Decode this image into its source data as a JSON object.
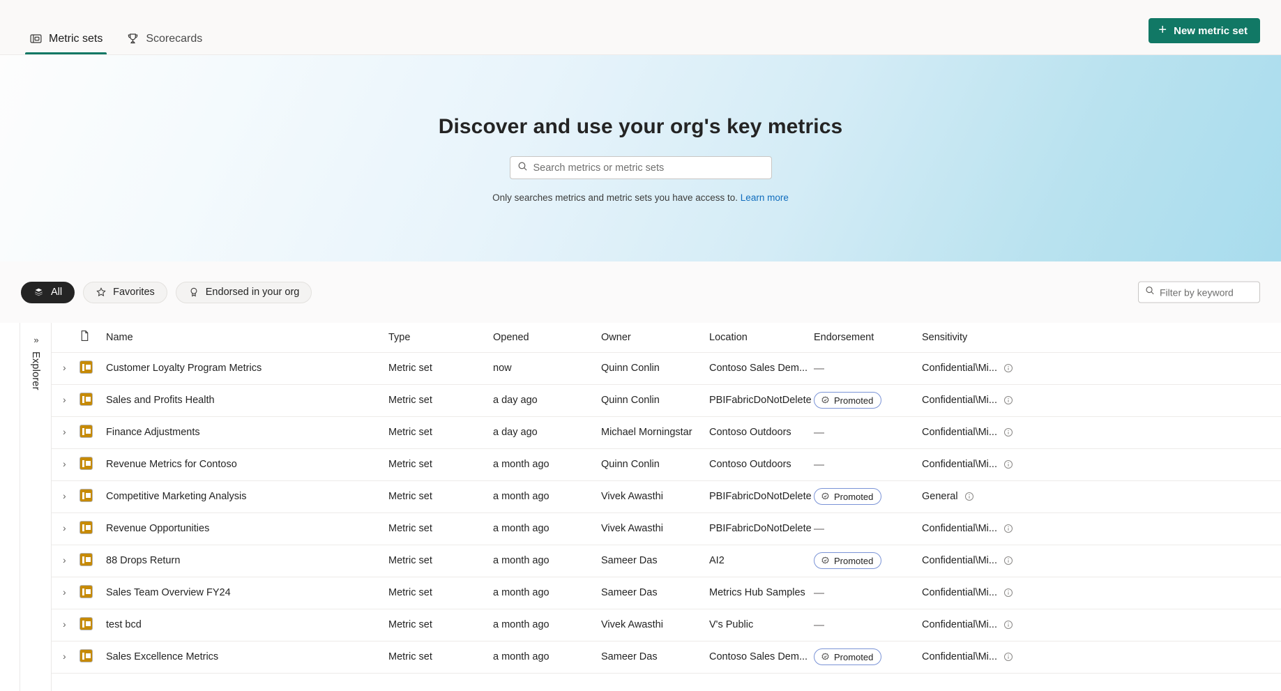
{
  "nav": {
    "tabs": [
      {
        "label": "Metric sets",
        "icon": "metric-set-icon",
        "active": true
      },
      {
        "label": "Scorecards",
        "icon": "trophy-icon",
        "active": false
      }
    ],
    "new_button": {
      "label": "New metric set",
      "icon": "plus-icon",
      "color": "#117865"
    }
  },
  "hero": {
    "title": "Discover and use your org's key metrics",
    "search": {
      "placeholder": "Search metrics or metric sets",
      "value": "",
      "icon": "search-icon"
    },
    "note": "Only searches metrics and metric sets you have access to.",
    "note_link": "Learn more",
    "link_color": "#0f6cbd"
  },
  "filters": {
    "pills": [
      {
        "label": "All",
        "icon": "stack-icon",
        "selected": true
      },
      {
        "label": "Favorites",
        "icon": "star-icon",
        "selected": false
      },
      {
        "label": "Endorsed in your org",
        "icon": "endorsement-icon",
        "selected": false
      }
    ],
    "keyword": {
      "placeholder": "Filter by keyword",
      "value": "",
      "icon": "search-icon"
    }
  },
  "explorer": {
    "label": "Explorer",
    "icon": "double-chevron-right-icon"
  },
  "table": {
    "columns": [
      "",
      "Name",
      "Type",
      "Opened",
      "Owner",
      "Location",
      "Endorsement",
      "Sensitivity"
    ],
    "header_icon": "document-icon",
    "rows": [
      {
        "name": "Customer Loyalty Program Metrics",
        "type": "Metric set",
        "opened": "now",
        "owner": "Quinn Conlin",
        "location": "Contoso Sales Dem...",
        "endorsement": "—",
        "sensitivity": "Confidential\\Mi..."
      },
      {
        "name": "Sales and Profits Health",
        "type": "Metric set",
        "opened": "a day ago",
        "owner": "Quinn Conlin",
        "location": "PBIFabricDoNotDelete",
        "endorsement": "Promoted",
        "sensitivity": "Confidential\\Mi..."
      },
      {
        "name": "Finance Adjustments",
        "type": "Metric set",
        "opened": "a day ago",
        "owner": "Michael Morningstar",
        "location": "Contoso Outdoors",
        "endorsement": "—",
        "sensitivity": "Confidential\\Mi..."
      },
      {
        "name": "Revenue Metrics for Contoso",
        "type": "Metric set",
        "opened": "a month ago",
        "owner": "Quinn Conlin",
        "location": "Contoso Outdoors",
        "endorsement": "—",
        "sensitivity": "Confidential\\Mi..."
      },
      {
        "name": "Competitive Marketing Analysis",
        "type": "Metric set",
        "opened": "a month ago",
        "owner": "Vivek Awasthi",
        "location": "PBIFabricDoNotDelete",
        "endorsement": "Promoted",
        "sensitivity": "General"
      },
      {
        "name": "Revenue Opportunities",
        "type": "Metric set",
        "opened": "a month ago",
        "owner": "Vivek Awasthi",
        "location": "PBIFabricDoNotDelete",
        "endorsement": "—",
        "sensitivity": "Confidential\\Mi..."
      },
      {
        "name": "88 Drops Return",
        "type": "Metric set",
        "opened": "a month ago",
        "owner": "Sameer Das",
        "location": "AI2",
        "endorsement": "Promoted",
        "sensitivity": "Confidential\\Mi..."
      },
      {
        "name": "Sales Team Overview FY24",
        "type": "Metric set",
        "opened": "a month ago",
        "owner": "Sameer Das",
        "location": "Metrics Hub Samples",
        "endorsement": "—",
        "sensitivity": "Confidential\\Mi..."
      },
      {
        "name": "test bcd",
        "type": "Metric set",
        "opened": "a month ago",
        "owner": "Vivek Awasthi",
        "location": "V's Public",
        "endorsement": "—",
        "sensitivity": "Confidential\\Mi..."
      },
      {
        "name": "Sales Excellence Metrics",
        "type": "Metric set",
        "opened": "a month ago",
        "owner": "Sameer Das",
        "location": "Contoso Sales Dem...",
        "endorsement": "Promoted",
        "sensitivity": "Confidential\\Mi..."
      }
    ]
  }
}
